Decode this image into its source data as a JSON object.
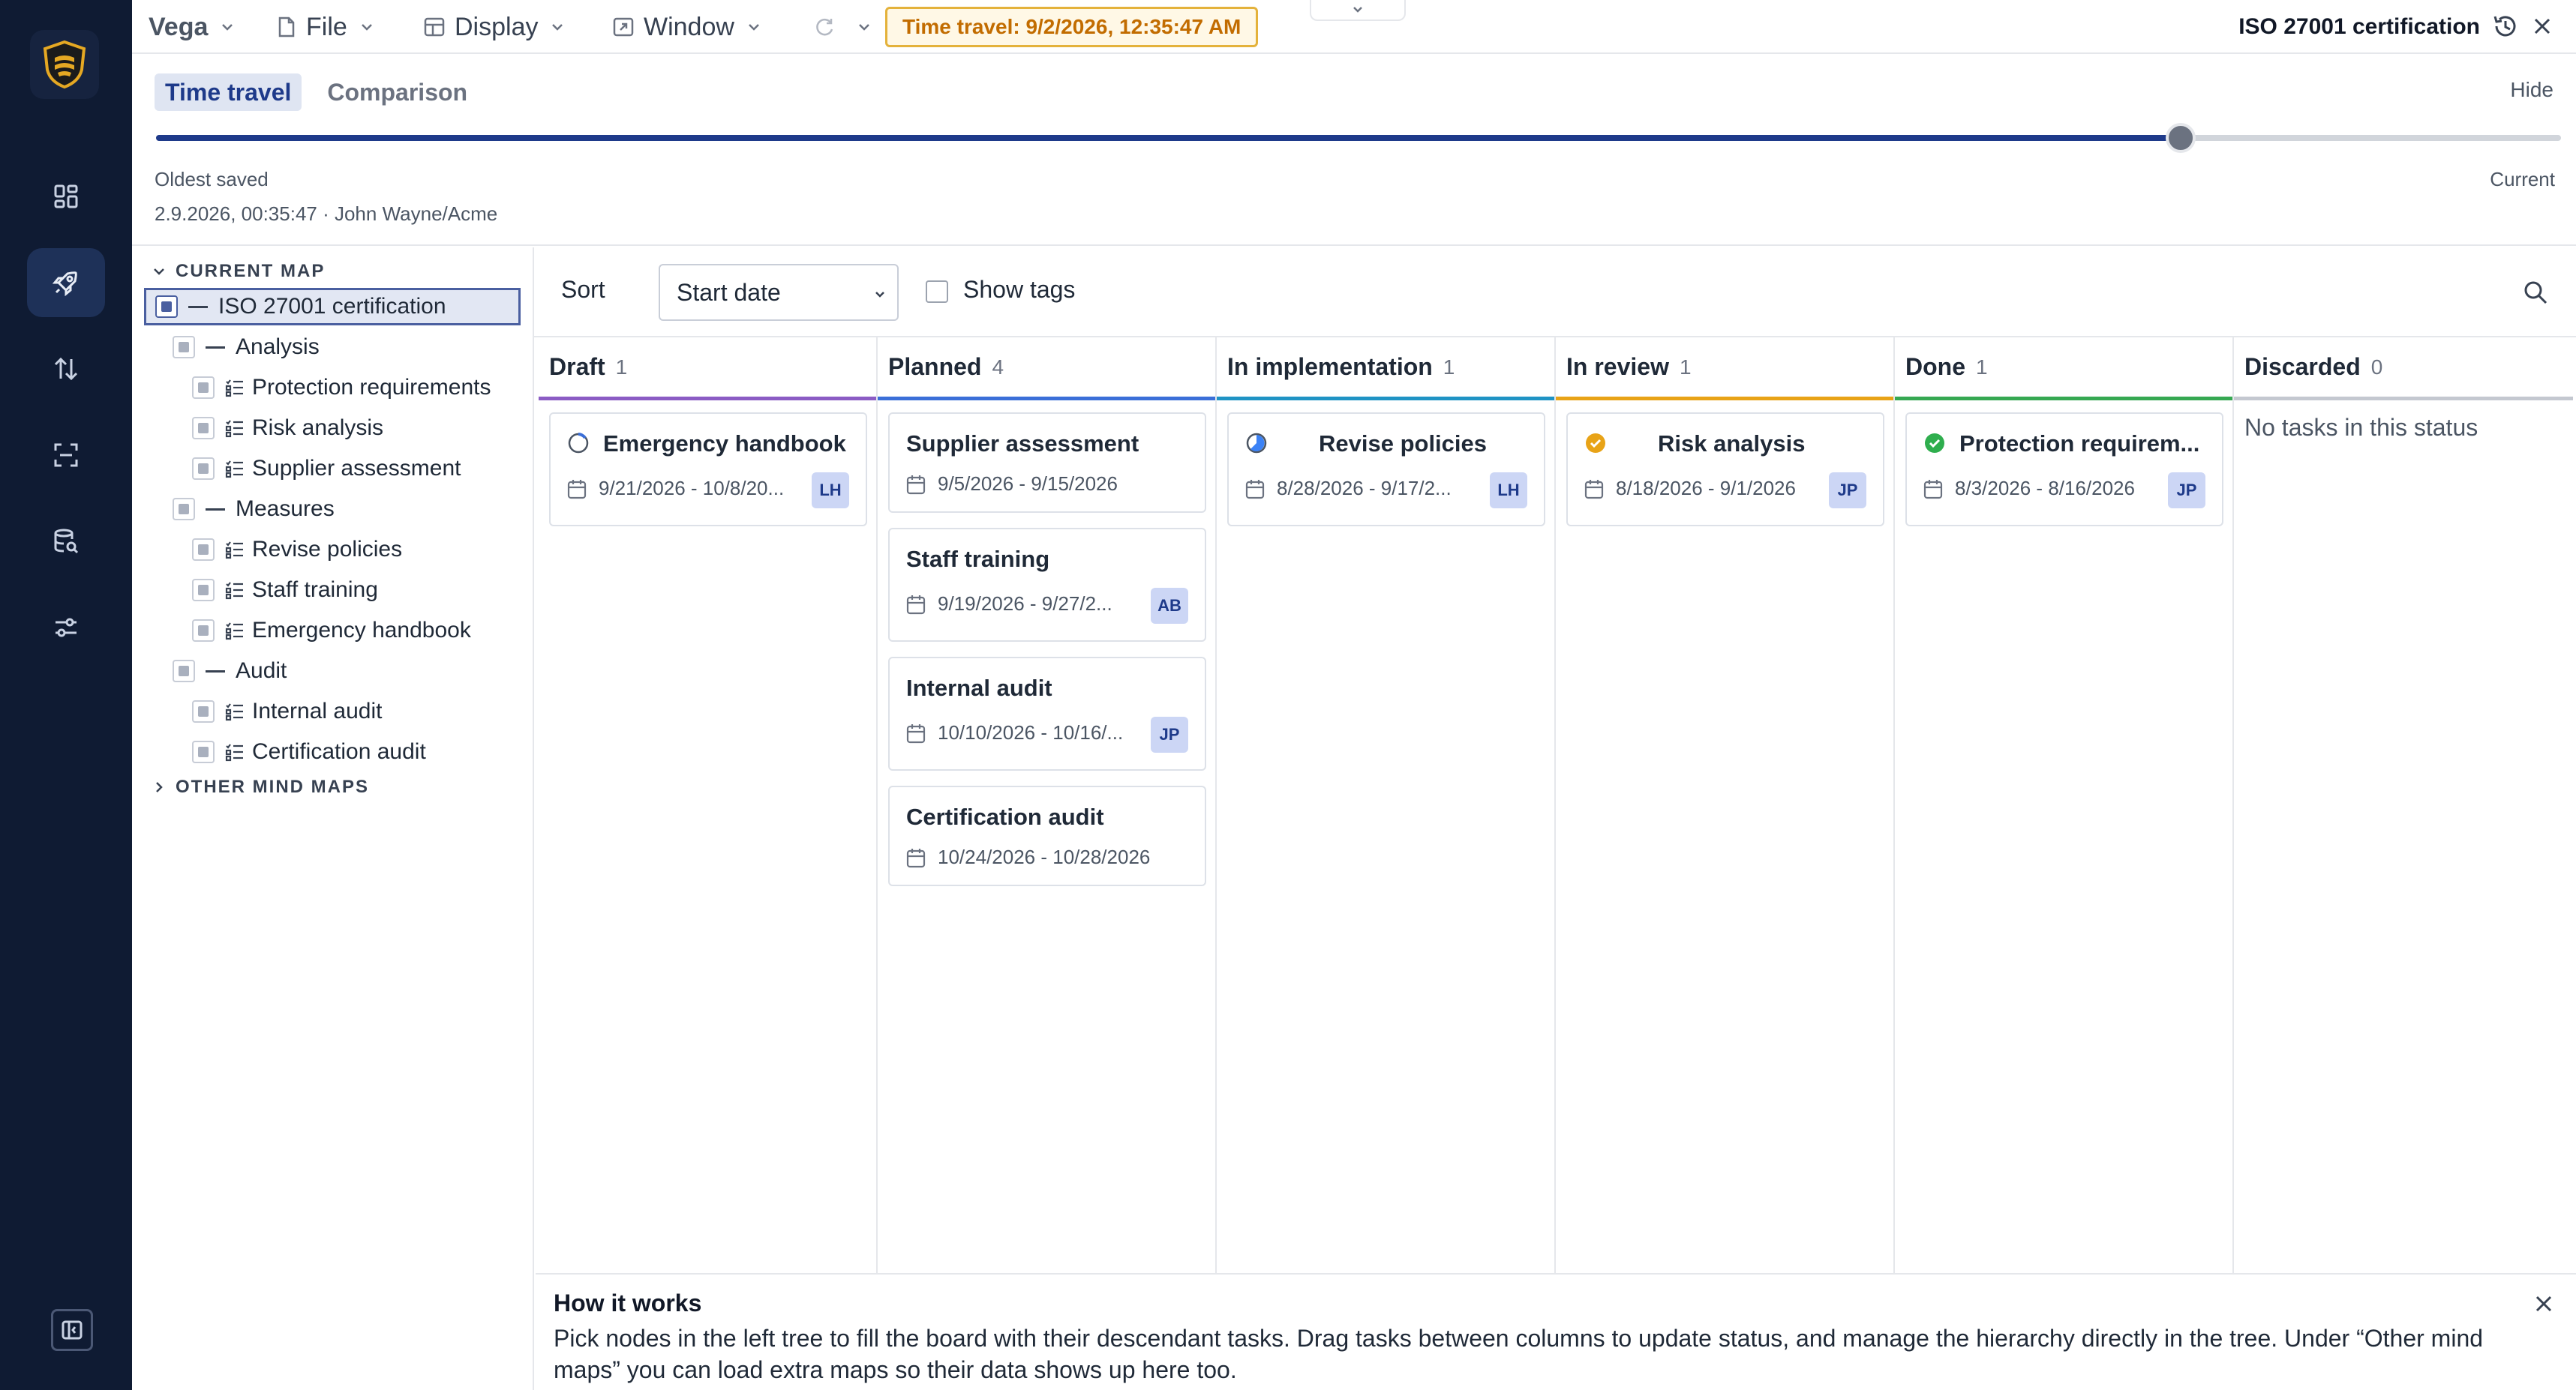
{
  "menubar": {
    "brand": "Vega",
    "file": "File",
    "display": "Display",
    "window": "Window",
    "time_travel_badge": "Time travel: 9/2/2026, 12:35:47 AM",
    "doc_title": "ISO 27001 certification"
  },
  "rail": {
    "items": [
      "dashboard-icon",
      "rocket-icon",
      "sort-arrows-icon",
      "scan-icon",
      "database-search-icon",
      "sliders-icon"
    ],
    "active_index": 1
  },
  "timetravel": {
    "tabs": [
      "Time travel",
      "Comparison"
    ],
    "active_tab": 0,
    "hide_label": "Hide",
    "slider_position": 0.842,
    "oldest_label": "Oldest saved",
    "oldest_meta": "2.9.2026, 00:35:47 · John Wayne/Acme",
    "current_label": "Current"
  },
  "tree": {
    "current_map_label": "CURRENT MAP",
    "other_maps_label": "OTHER MIND MAPS",
    "root": "ISO 27001 certification",
    "nodes": [
      {
        "label": "Analysis",
        "kind": "group"
      },
      {
        "label": "Protection requirements",
        "kind": "task"
      },
      {
        "label": "Risk analysis",
        "kind": "task"
      },
      {
        "label": "Supplier assessment",
        "kind": "task"
      },
      {
        "label": "Measures",
        "kind": "group"
      },
      {
        "label": "Revise policies",
        "kind": "task"
      },
      {
        "label": "Staff training",
        "kind": "task"
      },
      {
        "label": "Emergency handbook",
        "kind": "task"
      },
      {
        "label": "Audit",
        "kind": "group"
      },
      {
        "label": "Internal audit",
        "kind": "task"
      },
      {
        "label": "Certification audit",
        "kind": "task"
      }
    ]
  },
  "toolbar": {
    "sort_label": "Sort",
    "sort_value": "Start date",
    "show_tags_label": "Show tags"
  },
  "columns": [
    {
      "name": "Draft",
      "count": "1",
      "color": "#8b5cc4",
      "cards": [
        {
          "title": "Emergency handbook",
          "dates": "9/21/2026 - 10/8/20...",
          "assignee": "LH",
          "status_icon": "progress-start-icon"
        }
      ]
    },
    {
      "name": "Planned",
      "count": "4",
      "color": "#3b6fd8",
      "cards": [
        {
          "title": "Supplier assessment",
          "dates": "9/5/2026 - 9/15/2026",
          "assignee": "",
          "status_icon": ""
        },
        {
          "title": "Staff training",
          "dates": "9/19/2026 - 9/27/2...",
          "assignee": "AB",
          "status_icon": ""
        },
        {
          "title": "Internal audit",
          "dates": "10/10/2026 - 10/16/...",
          "assignee": "JP",
          "status_icon": ""
        },
        {
          "title": "Certification audit",
          "dates": "10/24/2026 - 10/28/2026",
          "assignee": "",
          "status_icon": ""
        }
      ]
    },
    {
      "name": "In implementation",
      "count": "1",
      "color": "#1f93c4",
      "cards": [
        {
          "title": "Revise policies",
          "dates": "8/28/2026 - 9/17/2...",
          "assignee": "LH",
          "status_icon": "progress-half-icon"
        }
      ]
    },
    {
      "name": "In review",
      "count": "1",
      "color": "#e8a317",
      "cards": [
        {
          "title": "Risk analysis",
          "dates": "8/18/2026 - 9/1/2026",
          "assignee": "JP",
          "status_icon": "review-check-icon"
        }
      ]
    },
    {
      "name": "Done",
      "count": "1",
      "color": "#36a852",
      "cards": [
        {
          "title": "Protection requirem...",
          "dates": "8/3/2026 - 8/16/2026",
          "assignee": "JP",
          "status_icon": "done-check-icon"
        }
      ]
    },
    {
      "name": "Discarded",
      "count": "0",
      "color": "#c4c8d0",
      "cards": [],
      "empty_text": "No tasks in this status"
    }
  ],
  "how_it_works": {
    "title": "How it works",
    "text": "Pick nodes in the left tree to fill the board with their descendant tasks. Drag tasks between columns to update status, and manage the hierarchy directly in the tree. Under “Other mind maps” you can load extra maps so their data shows up here too."
  }
}
